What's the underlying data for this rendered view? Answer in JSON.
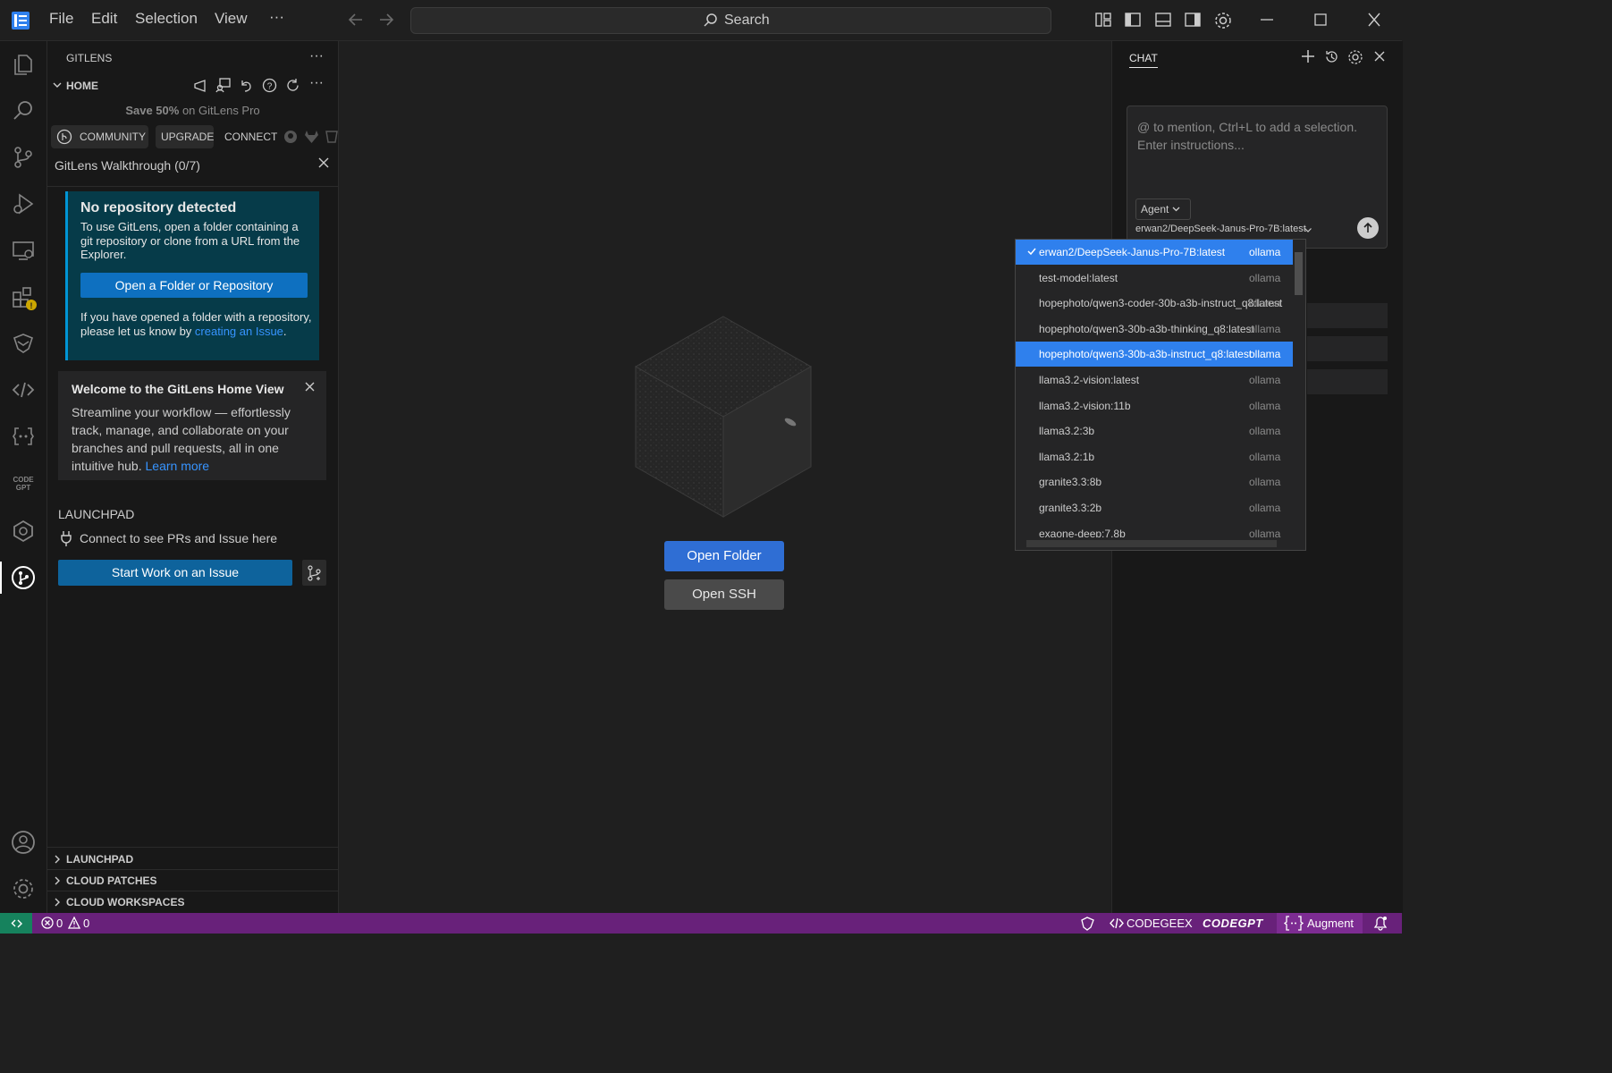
{
  "titlebar": {
    "menu": [
      "File",
      "Edit",
      "Selection",
      "View"
    ],
    "more": "···",
    "search_label": "Search"
  },
  "sidebar": {
    "panel_title": "GITLENS",
    "section_home": "HOME",
    "promo_bold": "Save 50%",
    "promo_rest": " on GitLens Pro",
    "plan_tabs": [
      "COMMUNITY",
      "UPGRADE",
      "CONNECT"
    ],
    "walkthrough": "GitLens Walkthrough (0/7)",
    "norepo": {
      "title": "No repository detected",
      "body": "To use GitLens, open a folder containing a git repository or clone from a URL from the Explorer.",
      "button": "Open a Folder or Repository",
      "note_pre": "If you have opened a folder with a repository, please let us know by ",
      "note_link": "creating an Issue",
      "note_post": "."
    },
    "welcome": {
      "title": "Welcome to the GitLens Home View",
      "body": "Streamline your workflow — effortlessly track, manage, and collaborate on your branches and pull requests, all in one intuitive hub. ",
      "link": "Learn more"
    },
    "launchpad": {
      "title": "LAUNCHPAD",
      "connect": "Connect to see PRs and Issue here",
      "start_button": "Start Work on an Issue"
    },
    "bottom_sections": [
      "LAUNCHPAD",
      "CLOUD PATCHES",
      "CLOUD WORKSPACES"
    ]
  },
  "editor": {
    "open_folder": "Open Folder",
    "open_ssh": "Open SSH"
  },
  "chat": {
    "tab": "CHAT",
    "placeholder": "@ to mention, Ctrl+L to add a selection. Enter instructions...",
    "mode": "Agent",
    "model": "erwan2/DeepSeek-Janus-Pro-7B:latest"
  },
  "model_dropdown": {
    "items": [
      {
        "name": "erwan2/DeepSeek-Janus-Pro-7B:latest",
        "provider": "ollama",
        "checked": true,
        "highlighted": true
      },
      {
        "name": "test-model:latest",
        "provider": "ollama"
      },
      {
        "name": "hopephoto/qwen3-coder-30b-a3b-instruct_q8:latest",
        "provider": "ollama"
      },
      {
        "name": "hopephoto/qwen3-30b-a3b-thinking_q8:latest",
        "provider": "ollama"
      },
      {
        "name": "hopephoto/qwen3-30b-a3b-instruct_q8:latest",
        "provider": "ollama",
        "highlighted": true
      },
      {
        "name": "llama3.2-vision:latest",
        "provider": "ollama"
      },
      {
        "name": "llama3.2-vision:11b",
        "provider": "ollama"
      },
      {
        "name": "llama3.2:3b",
        "provider": "ollama"
      },
      {
        "name": "llama3.2:1b",
        "provider": "ollama"
      },
      {
        "name": "granite3.3:8b",
        "provider": "ollama"
      },
      {
        "name": "granite3.3:2b",
        "provider": "ollama"
      },
      {
        "name": "exaone-deep:7.8b",
        "provider": "ollama"
      }
    ]
  },
  "statusbar": {
    "errors": "0",
    "warnings": "0",
    "codegeex": "CODEGEEX",
    "codegpt": "CODEGPT",
    "augment": "Augment",
    "bg_color": "#68217a"
  }
}
